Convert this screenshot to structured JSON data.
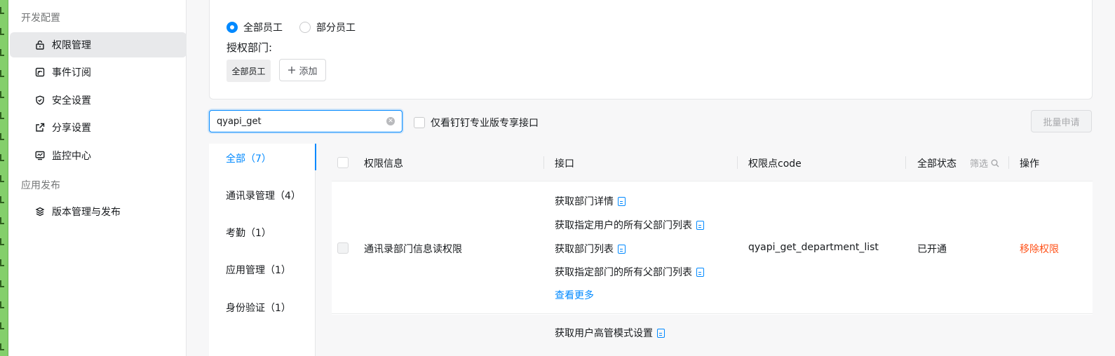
{
  "sidebar": {
    "group_dev": "开发配置",
    "items": [
      {
        "label": "权限管理",
        "icon": "unlock-icon"
      },
      {
        "label": "事件订阅",
        "icon": "event-subscribe-icon"
      },
      {
        "label": "安全设置",
        "icon": "shield-icon"
      },
      {
        "label": "分享设置",
        "icon": "share-icon"
      },
      {
        "label": "监控中心",
        "icon": "monitor-icon"
      }
    ],
    "group_publish": "应用发布",
    "publish_items": [
      {
        "label": "版本管理与发布",
        "icon": "layers-icon"
      }
    ]
  },
  "scope": {
    "options": [
      "全部员工",
      "部分员工"
    ],
    "selected": "全部员工",
    "auth_dept_label": "授权部门:",
    "dept_chip": "全部员工",
    "add_label": "添加"
  },
  "search": {
    "value": "qyapi_get",
    "only_pro_label": "仅看钉钉专业版专享接口",
    "batch_apply_label": "批量申请"
  },
  "categories": [
    {
      "label": "全部（7）",
      "active": true
    },
    {
      "label": "通讯录管理（4）",
      "active": false
    },
    {
      "label": "考勤（1）",
      "active": false
    },
    {
      "label": "应用管理（1）",
      "active": false
    },
    {
      "label": "身份验证（1）",
      "active": false
    }
  ],
  "table": {
    "headers": {
      "info": "权限信息",
      "api": "接口",
      "code": "权限点code",
      "status": "全部状态",
      "filter": "筛选",
      "action": "操作"
    },
    "rows": [
      {
        "info": "通讯录部门信息读权限",
        "apis": [
          "获取部门详情",
          "获取指定用户的所有父部门列表",
          "获取部门列表",
          "获取指定部门的所有父部门列表"
        ],
        "more": "查看更多",
        "code": "qyapi_get_department_list",
        "status": "已开通",
        "action": "移除权限"
      },
      {
        "apis": [
          "获取用户高管模式设置"
        ]
      }
    ]
  },
  "colors": {
    "accent": "#0089ff",
    "danger": "#ff5219",
    "strip": "#84cf6b"
  }
}
